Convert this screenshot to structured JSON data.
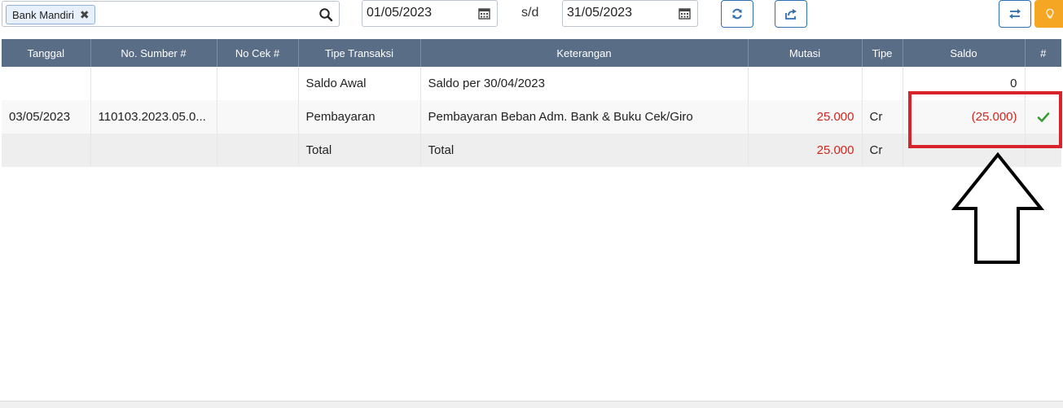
{
  "filter": {
    "account_tag": "Bank Mandiri",
    "remove_glyph": "✖",
    "date_from": "01/05/2023",
    "range_separator": "s/d",
    "date_to": "31/05/2023"
  },
  "table": {
    "columns": [
      "Tanggal",
      "No. Sumber #",
      "No Cek #",
      "Tipe Transaksi",
      "Keterangan",
      "Mutasi",
      "Tipe",
      "Saldo",
      "#"
    ],
    "rows": [
      {
        "tanggal": "",
        "no_sumber": "",
        "no_cek": "",
        "tipe_transaksi": "Saldo Awal",
        "keterangan": "Saldo per 30/04/2023",
        "mutasi": "",
        "tipe": "",
        "saldo": "0"
      },
      {
        "tanggal": "03/05/2023",
        "no_sumber": "110103.2023.05.0...",
        "no_cek": "",
        "tipe_transaksi": "Pembayaran",
        "keterangan": "Pembayaran Beban Adm. Bank & Buku Cek/Giro",
        "mutasi": "25.000",
        "tipe": "Cr",
        "saldo": "(25.000)"
      }
    ],
    "total": {
      "tipe_transaksi": "Total",
      "keterangan": "Total",
      "mutasi": "25.000",
      "tipe": "Cr"
    }
  },
  "icons": {
    "search": "search-icon",
    "calendar": "calendar-icon",
    "refresh": "refresh-icon",
    "export": "export-icon",
    "swap": "swap-icon",
    "bulb": "lightbulb-icon",
    "check": "check-icon"
  },
  "colors": {
    "header_bg": "#5a6d87",
    "negative_text": "#d0261b",
    "button_border": "#2f6fb3",
    "accent_orange": "#f5a623",
    "check_green": "#3a9a2f",
    "annotation_red": "#d9232a"
  }
}
